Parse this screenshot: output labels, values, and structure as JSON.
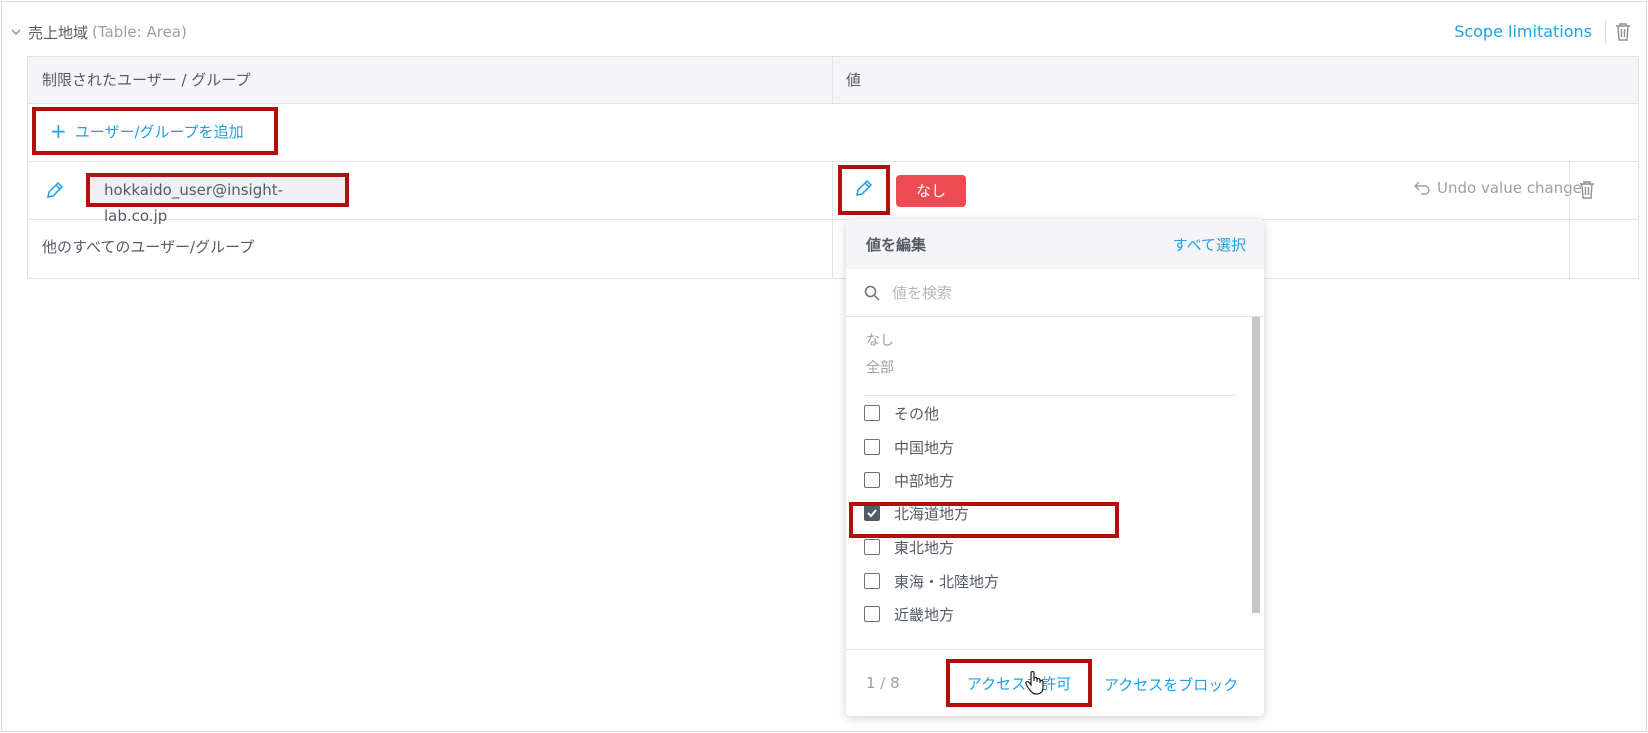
{
  "section": {
    "title": "売上地域",
    "subtitle": "(Table: Area)",
    "scope_link": "Scope limitations"
  },
  "table": {
    "headers": [
      "制限されたユーザー / グループ",
      "値"
    ],
    "add_button": "ユーザー/グループを追加",
    "user_row": {
      "user": "hokkaido_user@insight-lab.co.jp",
      "value_badge": "なし",
      "undo": "Undo value change"
    },
    "other_row": {
      "label": "他のすべてのユーザー/グループ"
    }
  },
  "dropdown": {
    "title": "値を編集",
    "select_all": "すべて選択",
    "search_placeholder": "値を検索",
    "special": [
      "なし",
      "全部"
    ],
    "items": [
      {
        "label": "その他",
        "checked": false
      },
      {
        "label": "中国地方",
        "checked": false
      },
      {
        "label": "中部地方",
        "checked": false
      },
      {
        "label": "北海道地方",
        "checked": true
      },
      {
        "label": "東北地方",
        "checked": false
      },
      {
        "label": "東海・北陸地方",
        "checked": false
      },
      {
        "label": "近畿地方",
        "checked": false
      }
    ],
    "count": "1 / 8",
    "allow": "アクセスを許可",
    "block": "アクセスをブロック"
  },
  "colors": {
    "accent": "#1ea1e3",
    "badge": "#ee4a52",
    "highlight": "#b10e0e"
  },
  "icons": [
    "chevron-down-icon",
    "trash-icon",
    "plus-icon",
    "pencil-icon",
    "undo-icon",
    "search-icon",
    "checkmark-icon",
    "hand-cursor-icon"
  ]
}
